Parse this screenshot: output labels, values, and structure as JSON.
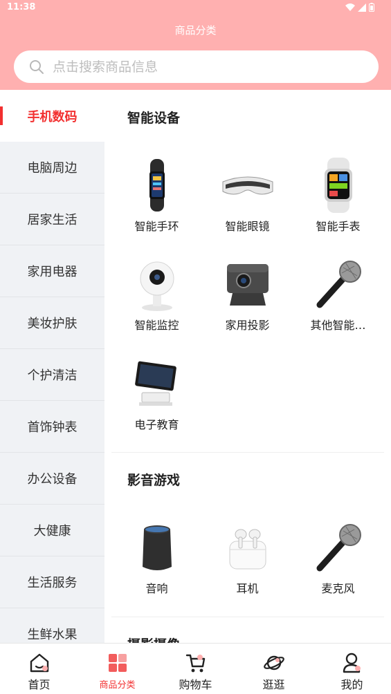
{
  "status_bar": {
    "time": "11:38"
  },
  "header": {
    "title": "商品分类"
  },
  "search": {
    "placeholder": "点击搜索商品信息"
  },
  "sidebar": {
    "items": [
      {
        "label": "手机数码",
        "active": true
      },
      {
        "label": "电脑周边"
      },
      {
        "label": "居家生活"
      },
      {
        "label": "家用电器"
      },
      {
        "label": "美妆护肤"
      },
      {
        "label": "个护清洁"
      },
      {
        "label": "首饰钟表"
      },
      {
        "label": "办公设备"
      },
      {
        "label": "大健康"
      },
      {
        "label": "生活服务"
      },
      {
        "label": "生鲜水果"
      }
    ]
  },
  "sections": [
    {
      "title": "智能设备",
      "items": [
        {
          "label": "智能手环",
          "icon": "smart-band-icon"
        },
        {
          "label": "智能眼镜",
          "icon": "vr-glasses-icon"
        },
        {
          "label": "智能手表",
          "icon": "smart-watch-icon"
        },
        {
          "label": "智能监控",
          "icon": "security-camera-icon"
        },
        {
          "label": "家用投影",
          "icon": "projector-icon"
        },
        {
          "label": "其他智能…",
          "icon": "microphone-icon"
        },
        {
          "label": "电子教育",
          "icon": "education-terminal-icon"
        }
      ]
    },
    {
      "title": "影音游戏",
      "items": [
        {
          "label": "音响",
          "icon": "smart-speaker-icon"
        },
        {
          "label": "耳机",
          "icon": "earbuds-icon"
        },
        {
          "label": "麦克风",
          "icon": "microphone-icon"
        }
      ]
    },
    {
      "title": "摄影摄像"
    }
  ],
  "tabbar": {
    "items": [
      {
        "label": "首页",
        "icon": "home-icon"
      },
      {
        "label": "商品分类",
        "icon": "category-grid-icon",
        "active": true
      },
      {
        "label": "购物车",
        "icon": "cart-icon"
      },
      {
        "label": "逛逛",
        "icon": "planet-icon"
      },
      {
        "label": "我的",
        "icon": "profile-icon"
      }
    ]
  },
  "colors": {
    "header_bg": "#ffb0b0",
    "accent": "#f23030",
    "sidebar_bg": "#f0f2f5"
  }
}
